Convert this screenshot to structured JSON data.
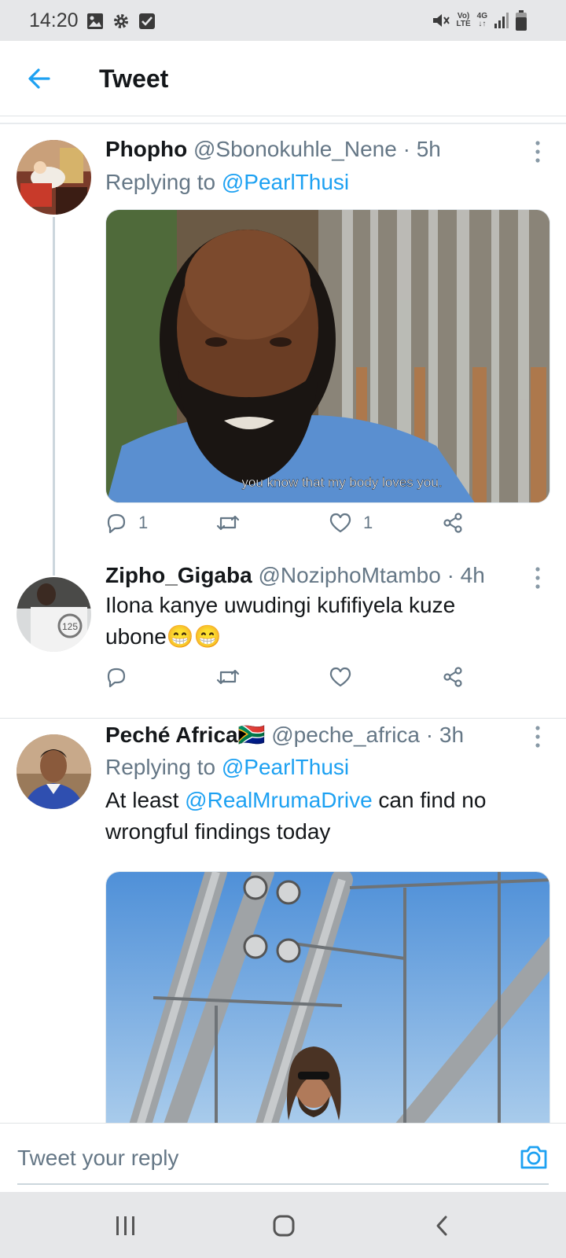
{
  "status_bar": {
    "time": "14:20",
    "network_labels": {
      "volte_top": "Vo)",
      "volte_bottom": "LTE",
      "data_top": "4G",
      "data_bottom": "↓↑"
    },
    "icons": [
      "image-icon",
      "gear-icon",
      "checkbox-icon",
      "mute-icon",
      "signal-icon",
      "battery-icon"
    ]
  },
  "header": {
    "title": "Tweet",
    "back_icon": "arrow-left-icon"
  },
  "tweets": [
    {
      "name": "Phopho",
      "handle": "@Sbonokuhle_Nene",
      "sep": "·",
      "time": "5h",
      "replying_prefix": "Replying to ",
      "replying_to": "@PearlThusi",
      "media_caption": "you know that my body loves you.",
      "actions": {
        "replies": "1",
        "retweets": "",
        "likes": "1"
      }
    },
    {
      "name": "Zipho_Gigaba",
      "handle": "@NoziphoMtambo",
      "sep": "·",
      "time": "4h",
      "text_line1": "Ilona kanye uwudingi kufifiyela kuze",
      "text_line2": "ubone😁😁",
      "avatar_badge": "125",
      "actions": {
        "replies": "",
        "retweets": "",
        "likes": ""
      }
    },
    {
      "name": "Peché Africa🇿🇦",
      "handle": "@peche_africa",
      "sep": "·",
      "time": "3h",
      "replying_prefix": "Replying to ",
      "replying_to": "@PearlThusi",
      "text_prefix": "At least ",
      "text_mention": "@RealMrumaDrive",
      "text_suffix": " can find no",
      "text_line2": "wrongful findings today"
    }
  ],
  "reply_bar": {
    "placeholder": "Tweet your reply",
    "camera_icon": "camera-icon"
  },
  "nav_bar": {
    "icons": [
      "recent-apps-icon",
      "home-icon",
      "back-icon"
    ]
  },
  "colors": {
    "accent": "#1da1f2",
    "secondary_text": "#657786",
    "primary_text": "#14171a",
    "status_bar_bg": "#e6e7e9"
  }
}
